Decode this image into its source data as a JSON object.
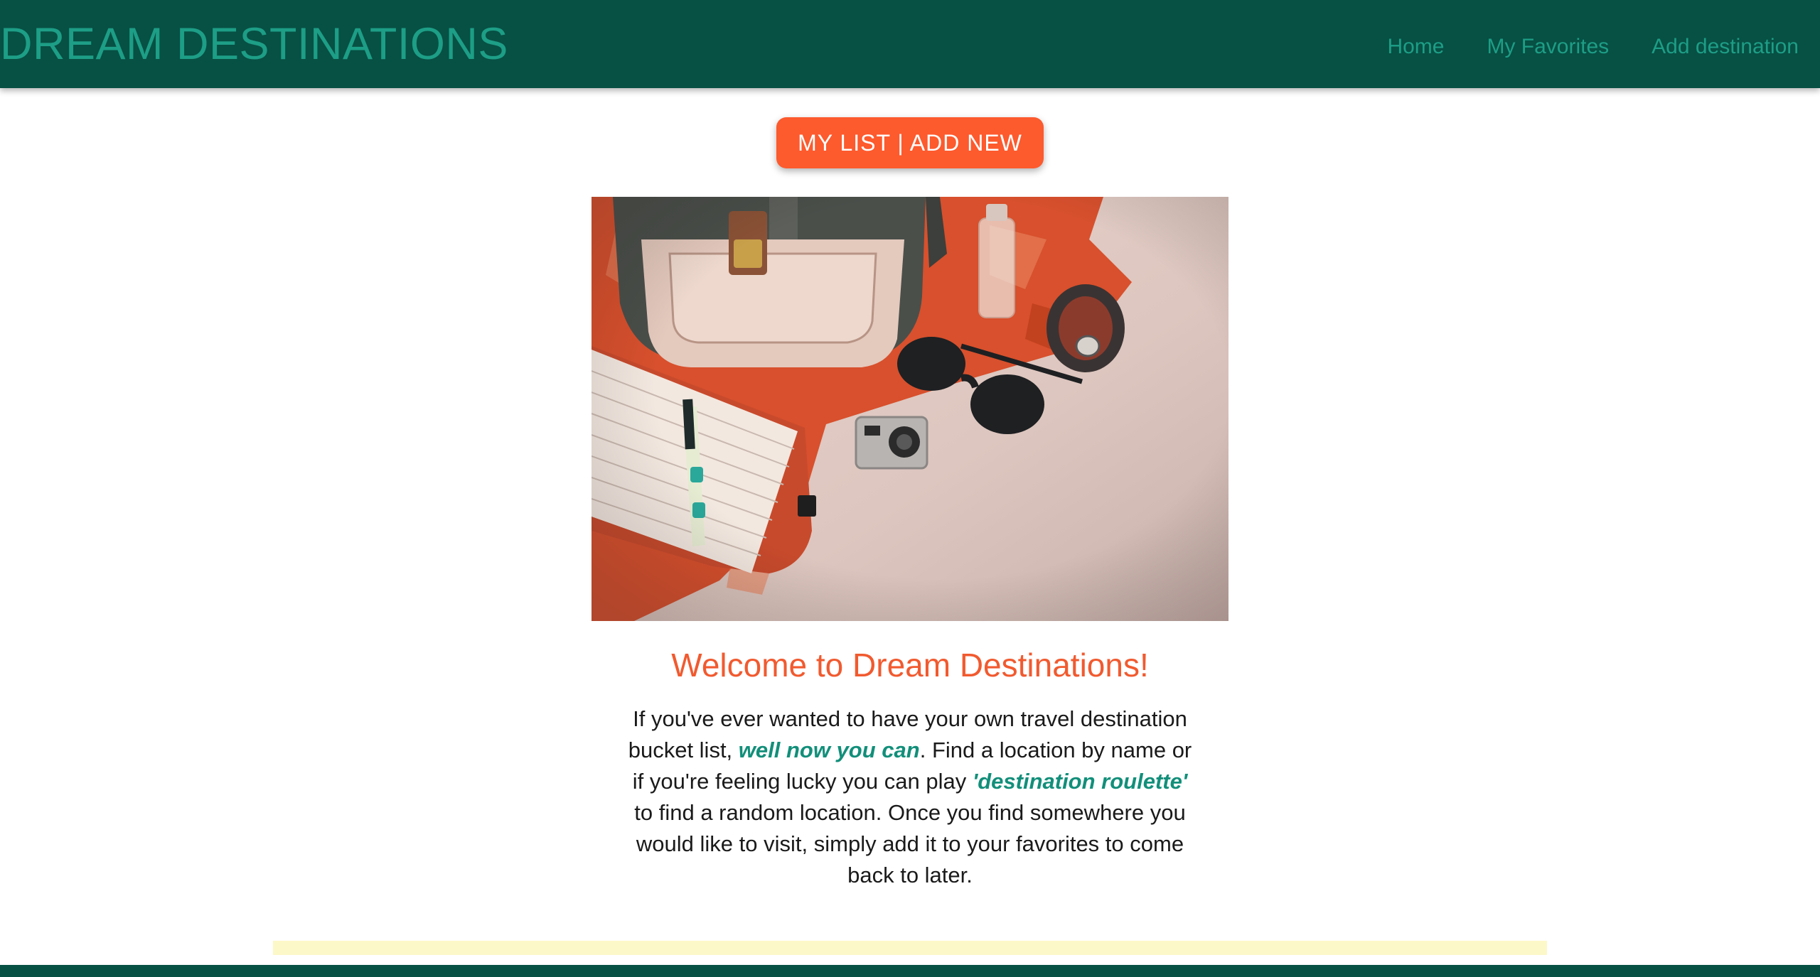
{
  "navbar": {
    "brand": "DREAM DESTINATIONS",
    "links": [
      {
        "label": "Home"
      },
      {
        "label": "My Favorites"
      },
      {
        "label": "Add destination"
      }
    ]
  },
  "main": {
    "cta_label": "MY LIST | ADD NEW",
    "hero_image_subject": "travel flat-lay: backpack, notebook with pen, sunglasses, action camera, wristwatch, perfume bottle on orange scarf",
    "welcome_heading": "Welcome to Dream Destinations!",
    "intro": {
      "part1": "If you've ever wanted to have your own travel destination bucket list, ",
      "highlight1": "well now you can",
      "part2": ". Find a location by name or if you're feeling lucky you can play ",
      "highlight2": "'destination roulette'",
      "part3": " to find a random location. Once you find somewhere you would like to visit, simply add it to your favorites to come back to later."
    }
  },
  "colors": {
    "navbar_bg": "#075044",
    "brand_text": "#1d9e86",
    "cta_bg": "#fd5a2d",
    "heading": "#f15a2f",
    "highlight": "#128f7a",
    "strip": "#fdf8c8"
  }
}
